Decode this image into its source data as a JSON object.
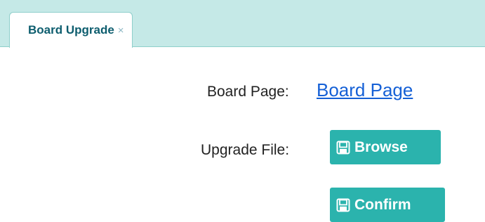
{
  "tabs": [
    {
      "label": "Board Upgrade",
      "close_glyph": "×"
    }
  ],
  "form": {
    "board_page_label": "Board Page:",
    "board_page_link": "Board Page",
    "upgrade_file_label": "Upgrade File:",
    "browse_label": "Browse",
    "confirm_label": "Confirm"
  },
  "icons": {
    "browse": "floppy-disk-icon",
    "confirm": "floppy-disk-icon",
    "tab_close": "close-icon"
  },
  "colors": {
    "tab_bar": "#c5e9e7",
    "tab_text": "#0d5d6e",
    "button": "#2bb3ad",
    "link": "#1560d6"
  }
}
